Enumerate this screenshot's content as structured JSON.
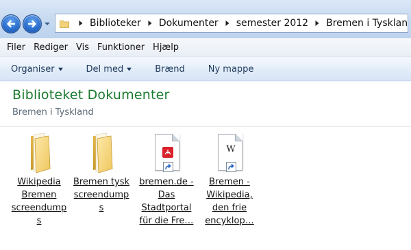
{
  "nav": {
    "back_icon": "back-arrow-icon",
    "forward_icon": "forward-arrow-icon",
    "history_icon": "chevron-down-icon"
  },
  "address": {
    "folder_icon": "folder-icon",
    "crumbs": [
      "Biblioteker",
      "Dokumenter",
      "semester 2012",
      "Bremen i Tyskland"
    ]
  },
  "menu": {
    "items": [
      "Filer",
      "Rediger",
      "Vis",
      "Funktioner",
      "Hjælp"
    ]
  },
  "commands": {
    "organize": "Organiser",
    "share": "Del med",
    "burn": "Brænd",
    "new_folder": "Ny mappe"
  },
  "library": {
    "title": "Biblioteket Dokumenter",
    "subtitle": "Bremen i Tyskland"
  },
  "items": [
    {
      "label": "Wikipedia Bremen screendumps",
      "icon": "folder-icon"
    },
    {
      "label": "Bremen tysk screendumps",
      "icon": "folder-icon"
    },
    {
      "label": "bremen.de - Das Stadtportal für die Fre…",
      "icon": "pdf-shortcut-icon"
    },
    {
      "label": "Bremen - Wikipedia, den frie encyklop…",
      "icon": "wikipedia-shortcut-icon"
    }
  ],
  "colors": {
    "title_green": "#1a7a2e",
    "nav_blue": "#2a6fcf",
    "folder_yellow": "#f0cf6a"
  }
}
